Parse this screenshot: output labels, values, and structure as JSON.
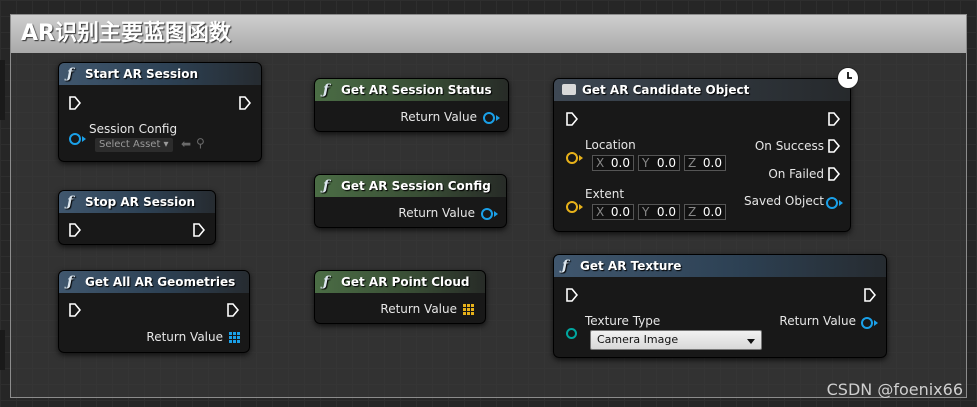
{
  "comment": {
    "title": "AR识别主要蓝图函数"
  },
  "nodes": {
    "start_session": {
      "title": "Start AR Session",
      "param_label": "Session Config",
      "asset_placeholder": "Select Asset"
    },
    "stop_session": {
      "title": "Stop AR Session"
    },
    "get_all_geometries": {
      "title": "Get All AR Geometries",
      "output": "Return Value"
    },
    "get_session_status": {
      "title": "Get AR Session Status",
      "output": "Return Value"
    },
    "get_session_config": {
      "title": "Get AR Session Config",
      "output": "Return Value"
    },
    "get_point_cloud": {
      "title": "Get AR Point Cloud",
      "output": "Return Value"
    },
    "get_candidate_object": {
      "title": "Get AR Candidate Object",
      "location_label": "Location",
      "extent_label": "Extent",
      "location": {
        "x": "0.0",
        "y": "0.0",
        "z": "0.0"
      },
      "extent": {
        "x": "0.0",
        "y": "0.0",
        "z": "0.0"
      },
      "axis": {
        "x": "X",
        "y": "Y",
        "z": "Z"
      },
      "on_success": "On Success",
      "on_failed": "On Failed",
      "saved_object": "Saved Object"
    },
    "get_texture": {
      "title": "Get AR Texture",
      "param_label": "Texture Type",
      "selected": "Camera Image",
      "output": "Return Value"
    }
  },
  "icons": {
    "function": "ƒ",
    "node_latent": "clock-icon",
    "object_node": "box-icon"
  },
  "colors": {
    "object_pin": "#1aa0e8",
    "struct_pin": "#e8b21a",
    "enum_pin": "#00a7a0",
    "array_pin": "#1aa0e8",
    "point_array_pin": "#e8b21a"
  },
  "watermark": "CSDN @foenix66"
}
